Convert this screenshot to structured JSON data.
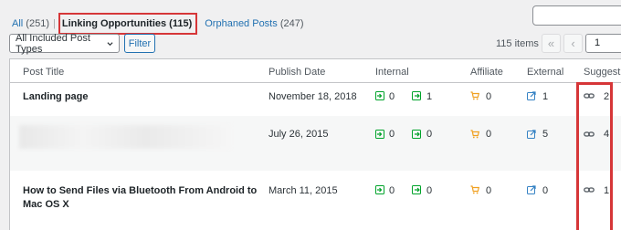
{
  "views": {
    "all_label": "All",
    "all_count": "(251)",
    "separator": "|",
    "linking_label": "Linking Opportunities (115)",
    "orphan_label": "Orphaned Posts",
    "orphan_count": "(247)"
  },
  "toolbar": {
    "post_type_select": "All Included Post Types",
    "filter_button": "Filter",
    "items_count": "115 items",
    "first_page": "«",
    "prev_page": "‹",
    "current_page": "1"
  },
  "table": {
    "headers": {
      "title": "Post Title",
      "date": "Publish Date",
      "internal": "Internal",
      "affiliate": "Affiliate",
      "external": "External",
      "suggestions": "Suggestio"
    },
    "rows": [
      {
        "title": "Landing page",
        "date": "November 18, 2018",
        "internal_in": "0",
        "internal_out": "1",
        "affiliate": "0",
        "external": "1",
        "suggestions": "2"
      },
      {
        "title": "",
        "date": "July 26, 2015",
        "internal_in": "0",
        "internal_out": "0",
        "affiliate": "0",
        "external": "5",
        "suggestions": "4"
      },
      {
        "title": "How to Send Files via Bluetooth From Android to Mac OS X",
        "date": "March 11, 2015",
        "internal_in": "0",
        "internal_out": "0",
        "affiliate": "0",
        "external": "0",
        "suggestions": "1"
      }
    ]
  },
  "icons": {
    "inbound": "inbound-link-icon",
    "outbound": "outbound-link-icon",
    "affiliate": "cart-icon",
    "external": "external-link-icon",
    "suggestion": "link-chain-icon"
  },
  "colors": {
    "accent": "#2271b1",
    "green_icon": "#00a32a",
    "orange_icon": "#f0a020",
    "blue_icon": "#3582c4",
    "highlight": "#d63638"
  }
}
